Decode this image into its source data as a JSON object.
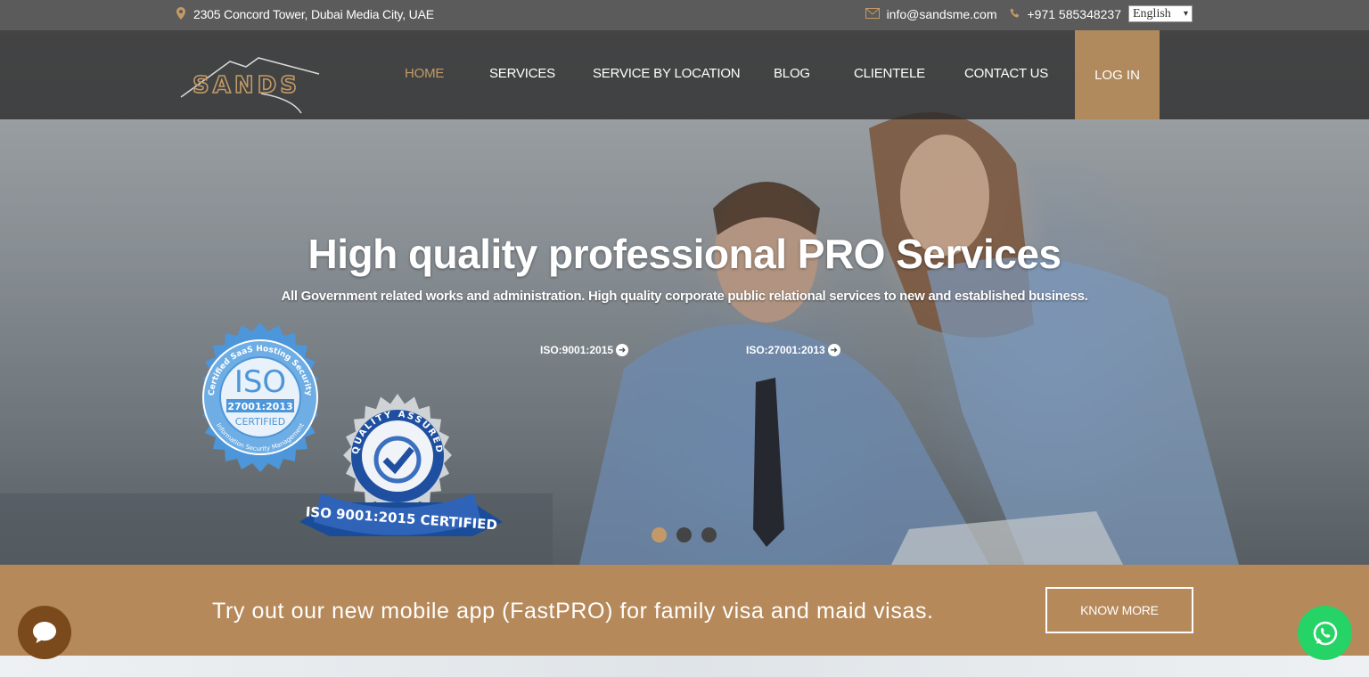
{
  "topbar": {
    "address": "2305 Concord Tower, Dubai Media City, UAE",
    "email": "info@sandsme.com",
    "phone": "+971 585348237",
    "language": "English",
    "icons": [
      "map-marker-icon",
      "envelope-icon",
      "phone-icon"
    ]
  },
  "logo": {
    "text": "SANDS"
  },
  "nav": {
    "items": [
      {
        "label": "HOME",
        "active": true
      },
      {
        "label": "SERVICES"
      },
      {
        "label": "SERVICE BY LOCATION"
      },
      {
        "label": "BLOG"
      },
      {
        "label": "CLIENTELE"
      },
      {
        "label": "CONTACT US"
      }
    ],
    "login": "LOG IN"
  },
  "hero": {
    "title": "High quality professional PRO Services",
    "subtitle": "All Government related works and administration. High quality corporate public relational services to new and established business.",
    "links": [
      "ISO:9001:2015",
      "ISO:27001:2013"
    ],
    "badge1": {
      "lines": [
        "Certified SaaS Hosting Security",
        "ISO",
        "27001:2013",
        "CERTIFIED",
        "Information Security Management"
      ]
    },
    "badge2": {
      "lines": [
        "QUALITY ASSURED",
        "ISO 9001:2015 CERTIFIED"
      ]
    },
    "slider": {
      "count": 3,
      "active": 1
    }
  },
  "promo": {
    "text": "Try out our new mobile app (FastPRO) for family visa and maid visas.",
    "button": "KNOW MORE"
  },
  "colors": {
    "accent": "#c39a67",
    "promo_bg": "#b6895a",
    "login_bg": "#b08a5c",
    "whatsapp": "#25d366"
  }
}
